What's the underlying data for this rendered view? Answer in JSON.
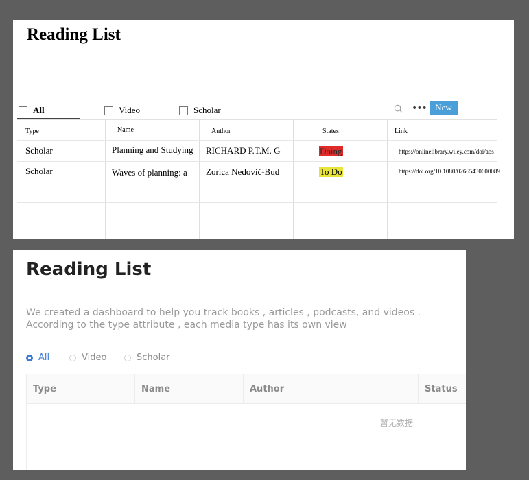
{
  "panel1": {
    "title": "Reading List",
    "filters": [
      {
        "label": "All",
        "active": true
      },
      {
        "label": "Video",
        "active": false
      },
      {
        "label": "Scholar",
        "active": false
      }
    ],
    "new_button_label": "New",
    "columns": [
      "Type",
      "Name",
      "Author",
      "States",
      "Link"
    ],
    "rows": [
      {
        "type": "Scholar",
        "name": "Planning and Studying",
        "author": "RICHARD P.T.M. G",
        "state": "Doing",
        "link": "https://onlinelibrary.wiley.com/doi/abs"
      },
      {
        "type": "Scholar",
        "name": "Waves of planning: a",
        "author": "Zorica Nedović-Bud",
        "state": "To Do",
        "link": "https://doi.org/10.1080/02665430600089"
      }
    ],
    "colors": {
      "doing": "#e02b2b",
      "todo": "#e9e439",
      "new_button": "#4a9fd9"
    },
    "icons": [
      "search-icon",
      "more-options-icon"
    ]
  },
  "panel2": {
    "title": "Reading List",
    "description_line1": "We created a dashboard to help you track books , articles , podcasts, and videos .",
    "description_line2": "According to the type attribute , each media type has its own view",
    "radios": [
      {
        "label": "All",
        "selected": true
      },
      {
        "label": "Video",
        "selected": false
      },
      {
        "label": "Scholar",
        "selected": false
      }
    ],
    "columns": [
      "Type",
      "Name",
      "Author",
      "Status"
    ],
    "empty_text": "暂无数据",
    "colors": {
      "accent": "#3d7bd6"
    }
  }
}
